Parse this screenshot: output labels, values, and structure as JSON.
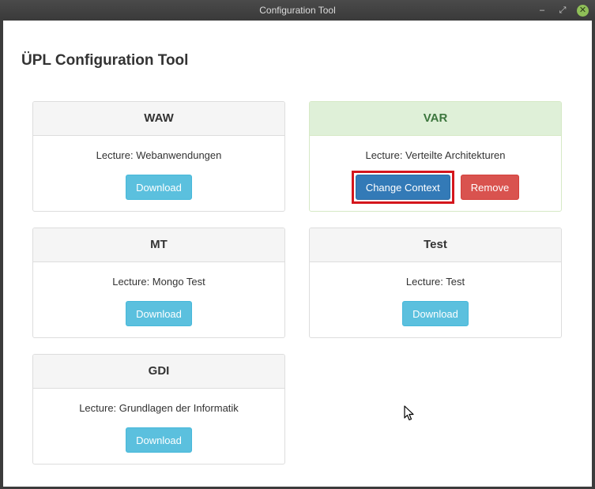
{
  "window": {
    "title": "Configuration Tool",
    "controls": {
      "minimize": "–",
      "maximize": "⤢",
      "close": "✕"
    }
  },
  "page": {
    "title": "ÜPL Configuration Tool"
  },
  "courses": [
    {
      "code": "WAW",
      "lecture": "Lecture: Webanwendungen",
      "download_label": "Download"
    },
    {
      "code": "VAR",
      "lecture": "Lecture: Verteilte Architekturen",
      "change_context_label": "Change Context",
      "remove_label": "Remove",
      "active": true
    },
    {
      "code": "MT",
      "lecture": "Lecture: Mongo Test",
      "download_label": "Download"
    },
    {
      "code": "Test",
      "lecture": "Lecture: Test",
      "download_label": "Download"
    },
    {
      "code": "GDI",
      "lecture": "Lecture: Grundlagen der Informatik",
      "download_label": "Download"
    }
  ],
  "colors": {
    "info": "#5bc0de",
    "primary": "#337ab7",
    "danger": "#d9534f",
    "success_heading": "#dff0d8",
    "highlight_border": "#d4161d"
  },
  "icons": {
    "cursor": "mouse-pointer-icon"
  }
}
